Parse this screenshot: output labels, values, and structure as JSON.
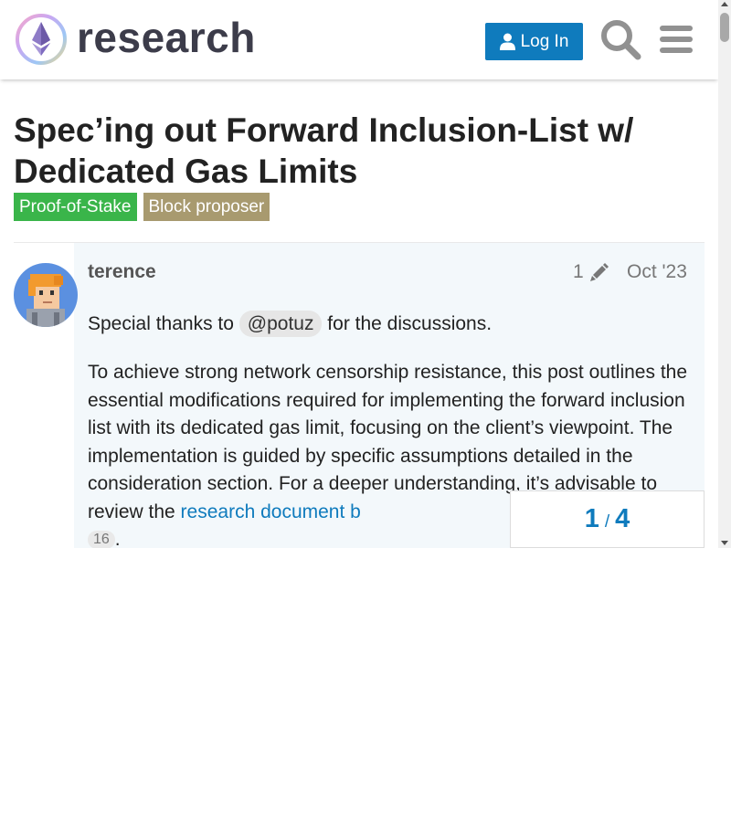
{
  "header": {
    "site_name": "research",
    "login_label": "Log In"
  },
  "topic": {
    "title": "Spec’ing out Forward Inclusion-List w/ Dedicated Gas Limits",
    "tags": [
      "Proof-of-Stake",
      "Block proposer"
    ]
  },
  "post": {
    "username": "terence",
    "edit_count": "1",
    "date": "Oct '23",
    "p1_before": "Special thanks to ",
    "mention": "@potuz",
    "p1_after": " for the discussions.",
    "p2_text": "To achieve strong network censorship resistance, this post outlines the essential modifications required for implementing the forward inclusion list with its dedicated gas limit, focusing on the client’s viewpoint. The implementation is guided by specific assumptions detailed in the consideration section. For a deeper understanding, it’s advisable to review the ",
    "p2_link": "research document b",
    "click_count": "16",
    "p2_end": "."
  },
  "timeline": {
    "current": "1",
    "separator": "/",
    "total": "4"
  },
  "colors": {
    "accent": "#0f7bbd",
    "tag_pos": "#3ab54a",
    "tag_bp": "#a89a6f",
    "post_bg": "#f3f8fb"
  },
  "icons": [
    "logo-icon",
    "user-icon",
    "search-icon",
    "hamburger-menu-icon",
    "pencil-icon",
    "avatar"
  ]
}
